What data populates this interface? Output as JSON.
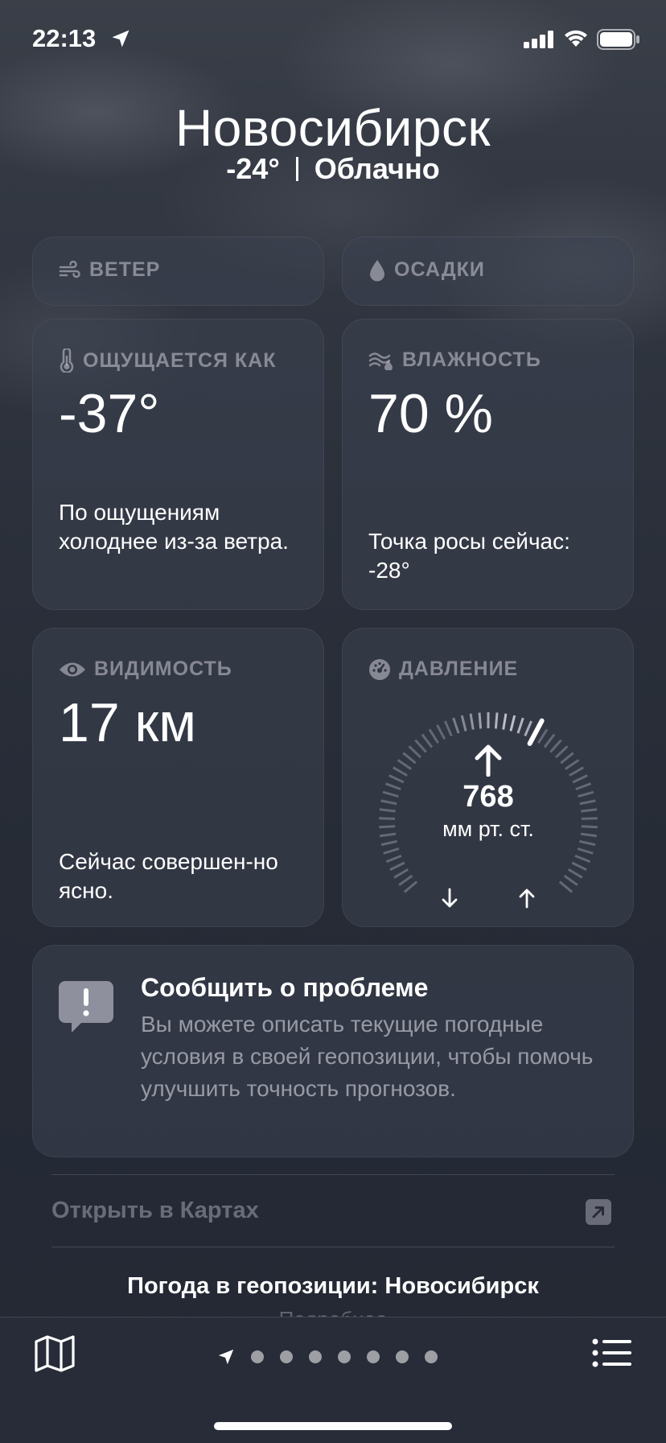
{
  "status_bar": {
    "time": "22:13"
  },
  "header": {
    "city": "Новосибирск",
    "temperature": "-24°",
    "condition": "Облачно"
  },
  "cards": {
    "wind": {
      "title": "ВЕТЕР"
    },
    "precip": {
      "title": "ОСАДКИ"
    },
    "feels_like": {
      "title": "ОЩУЩАЕТСЯ КАК",
      "value": "-37°",
      "description": "По ощущениям холоднее из-за ветра."
    },
    "humidity": {
      "title": "ВЛАЖНОСТЬ",
      "value": "70 %",
      "description": "Точка росы сейчас: -28°"
    },
    "visibility": {
      "title": "ВИДИМОСТЬ",
      "value": "17 км",
      "description": "Сейчас совершен-но ясно."
    },
    "pressure": {
      "title": "ДАВЛЕНИЕ",
      "value": "768",
      "unit": "мм рт. ст.",
      "trend": "rising"
    }
  },
  "report": {
    "title": "Сообщить о проблеме",
    "text": "Вы можете описать текущие погодные условия в своей геопозиции, чтобы помочь улучшить точность прогнозов."
  },
  "links": {
    "open_maps": "Открыть в Картах"
  },
  "footer": {
    "title": "Погода в геопозиции: Новосибирск",
    "subtitle": "Подробнее"
  },
  "tabbar": {
    "page_count": 7,
    "current_page": 0
  },
  "icons": [
    "location-arrow-icon",
    "signal-icon",
    "wifi-icon",
    "battery-icon",
    "wind-icon",
    "drop-icon",
    "thermometer-icon",
    "humidity-icon",
    "eye-icon",
    "gauge-icon",
    "speech-bubble-exclamation-icon",
    "external-link-arrow-icon",
    "map-icon",
    "list-icon"
  ]
}
